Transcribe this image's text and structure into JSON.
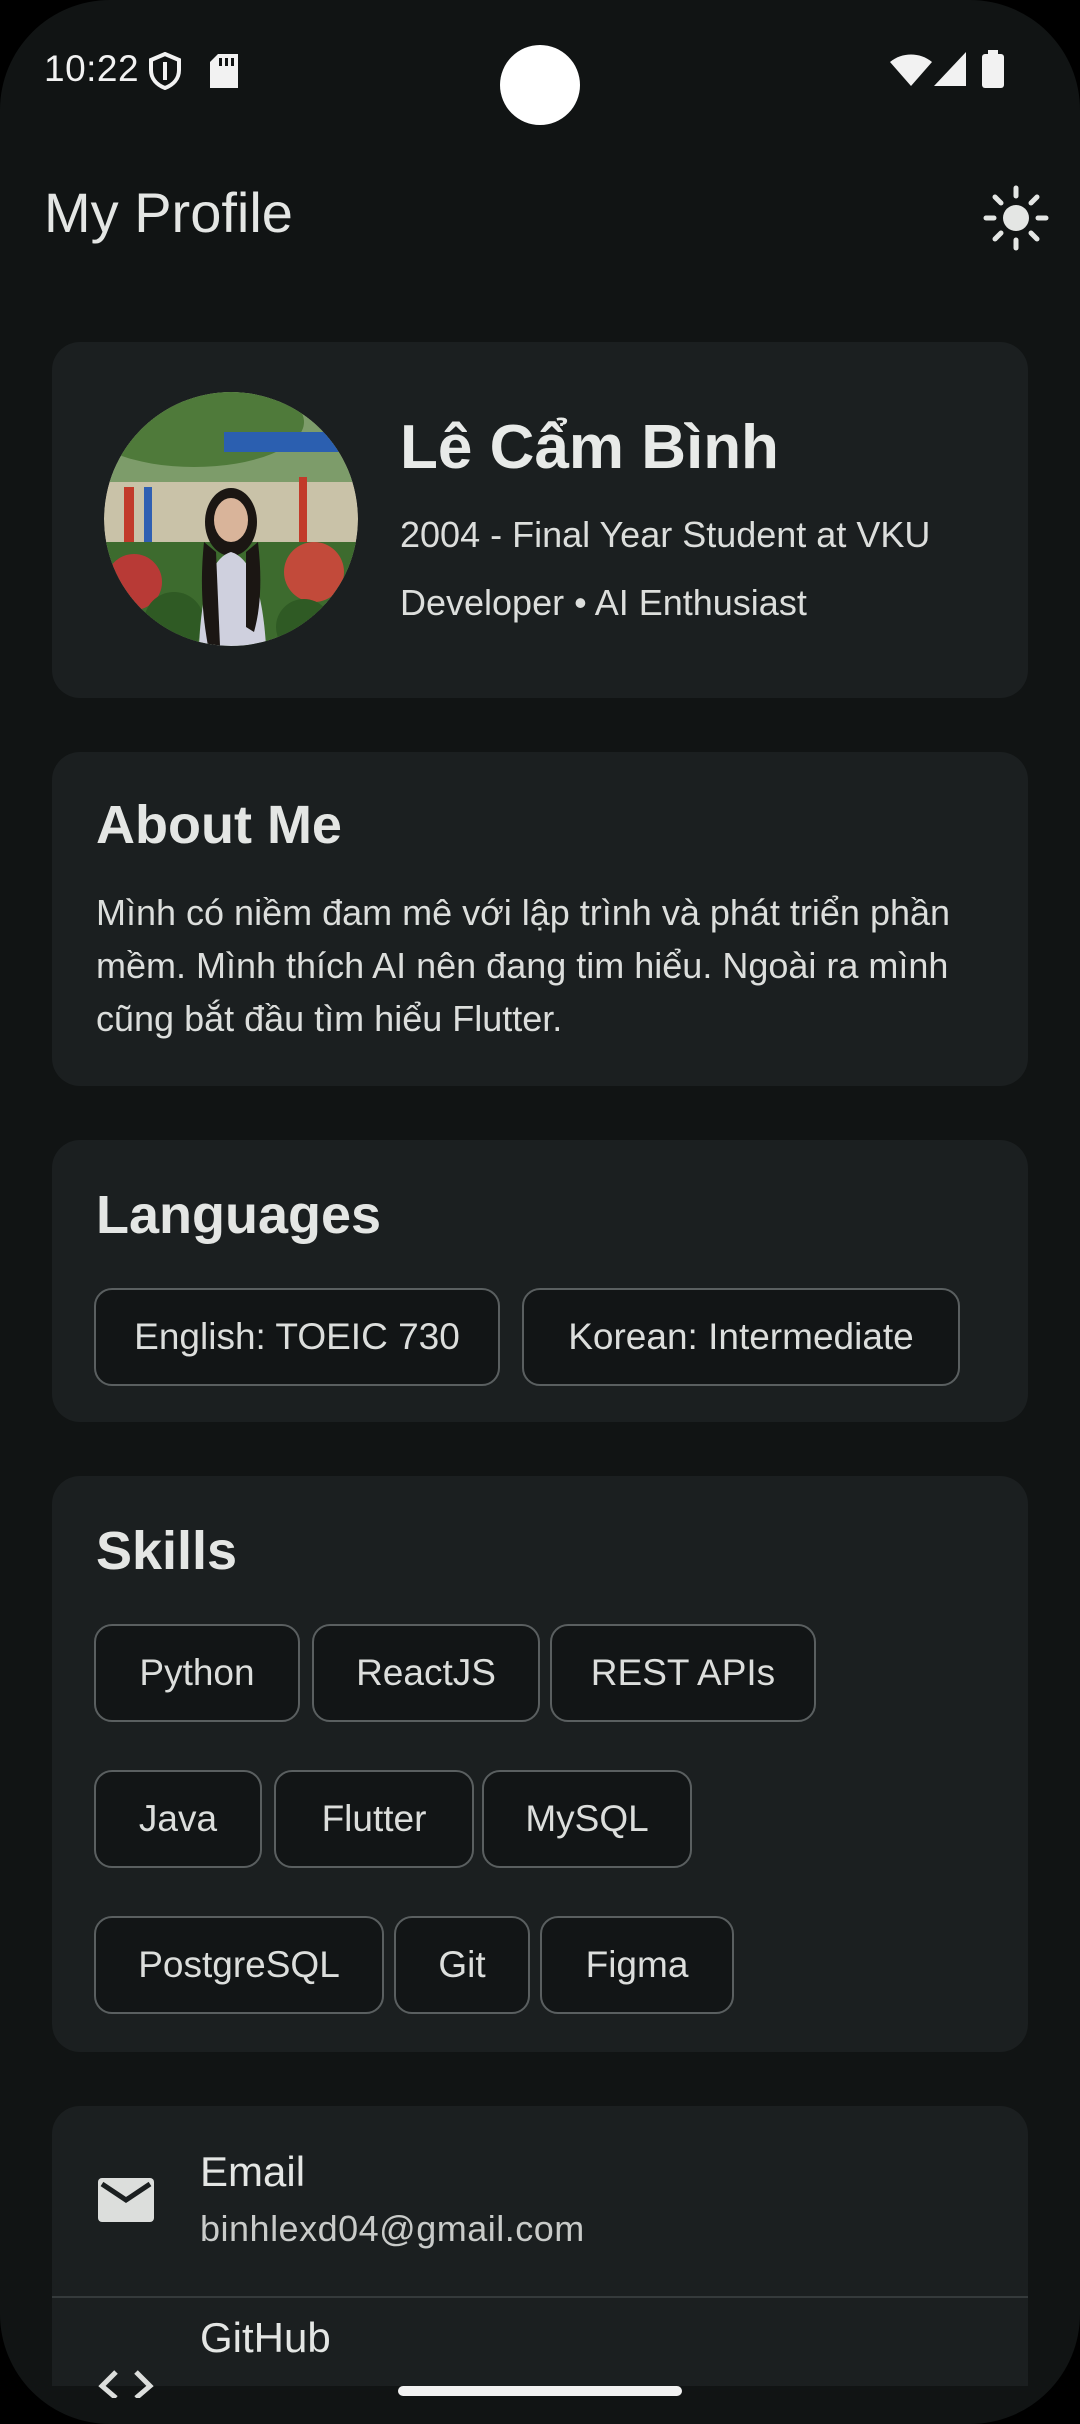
{
  "status_bar": {
    "time": "10:22",
    "icons": [
      "shield-icon",
      "sd-card-icon",
      "wifi-icon",
      "signal-icon",
      "battery-icon"
    ]
  },
  "app_bar": {
    "title": "My Profile",
    "action_icon": "sun-icon"
  },
  "profile": {
    "name": "Lê Cẩm Bình",
    "line1": "2004 - Final Year Student at VKU",
    "line2": "Developer • AI Enthusiast"
  },
  "about": {
    "title": "About Me",
    "text": "Mình có niềm đam mê với lập trình và phát triển phần mềm. Mình thích AI nên đang tim hiểu. Ngoài ra mình cũng bắt đầu tìm hiểu Flutter."
  },
  "languages": {
    "title": "Languages",
    "items": [
      "English: TOEIC 730",
      "Korean: Intermediate"
    ]
  },
  "skills": {
    "title": "Skills",
    "items": [
      "Python",
      "ReactJS",
      "REST APIs",
      "Java",
      "Flutter",
      "MySQL",
      "PostgreSQL",
      "Git",
      "Figma"
    ]
  },
  "contact": {
    "email_label": "Email",
    "email_value": "binhlexd04@gmail.com",
    "github_label": "GitHub"
  },
  "colors": {
    "background": "#111414",
    "card": "#1b1f20",
    "chip_border": "#5a5f60",
    "text": "#e1e3e1"
  }
}
